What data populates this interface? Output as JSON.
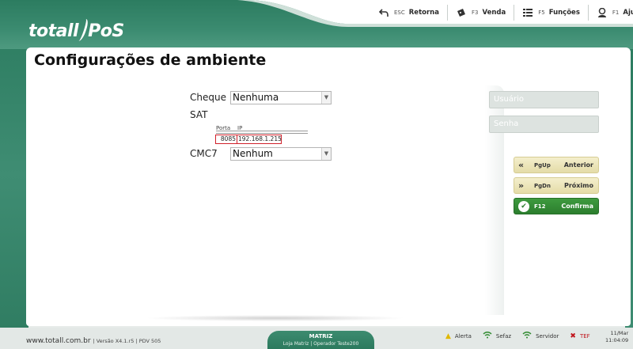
{
  "app": {
    "logo_text_left": "totall",
    "logo_text_right": "PoS"
  },
  "toolbar": [
    {
      "icon": "back-arrow-icon",
      "key": "ESC",
      "label": "Retorna"
    },
    {
      "icon": "ticket-icon",
      "key": "F3",
      "label": "Venda"
    },
    {
      "icon": "list-icon",
      "key": "F5",
      "label": "Funções"
    },
    {
      "icon": "help-person-icon",
      "key": "F1",
      "label": "Ajuda"
    }
  ],
  "page": {
    "title": "Configurações de ambiente"
  },
  "form": {
    "cheque_label": "Cheque",
    "cheque_value": "Nenhuma",
    "sat_label": "SAT",
    "sat_port_header": "Porta",
    "sat_ip_header": "IP",
    "sat_port_value": "8085",
    "sat_ip_value": "192.168.1.215",
    "cmc7_label": "CMC7",
    "cmc7_value": "Nenhum"
  },
  "side": {
    "user_placeholder": "Usuário",
    "password_placeholder": "Senha",
    "buttons": [
      {
        "icon": "double-chevron-left-icon",
        "key": "PgUp",
        "label": "Anterior"
      },
      {
        "icon": "double-chevron-right-icon",
        "key": "PgDn",
        "label": "Próximo"
      },
      {
        "icon": "check-circle-icon",
        "key": "F12",
        "label": "Confirma"
      }
    ]
  },
  "footer": {
    "url": "www.totall.com.br",
    "version": "| Versão X4.1.r5 | PDV 505",
    "store_name": "MATRIZ",
    "store_sub": "Loja Matriz | Operador Teste200",
    "status": [
      {
        "icon": "warning-icon",
        "label": "Alerta"
      },
      {
        "icon": "wifi-icon",
        "label": "Sefaz"
      },
      {
        "icon": "wifi-icon",
        "label": "Servidor"
      },
      {
        "icon": "close-icon",
        "label": "TEF"
      }
    ],
    "date": "11/Mar",
    "time": "11:04:09"
  },
  "colors": {
    "brand_teal": "#2c7c60",
    "confirm_green": "#2c7e2e",
    "nav_button_yellow": "#e4dca8",
    "highlight_red": "#d0202a"
  }
}
